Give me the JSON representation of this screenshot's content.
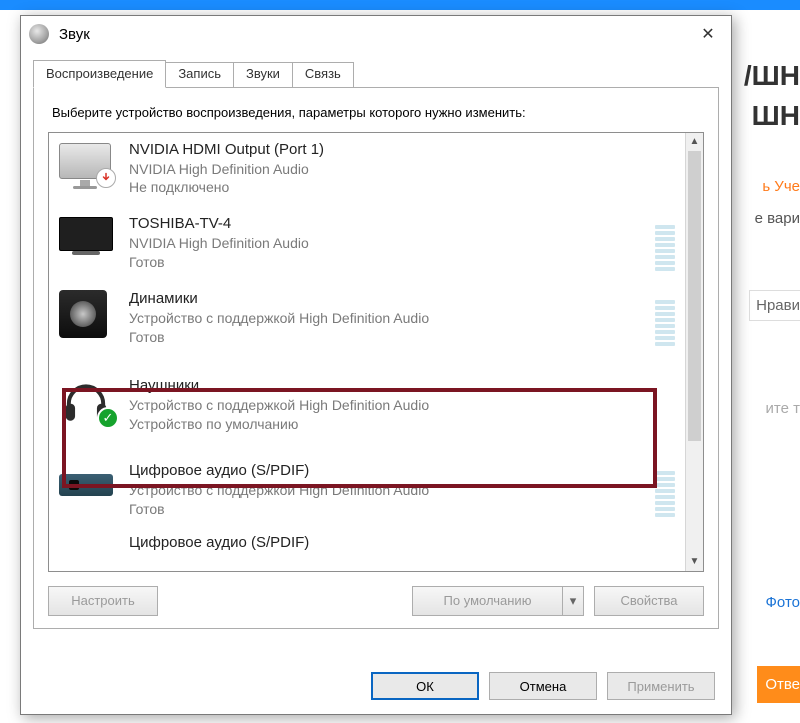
{
  "background": {
    "heading_frag1": "/ШН",
    "heading_frag2": "ШН",
    "line1": "ь Уче",
    "line2": "е вари",
    "like": "Нрави",
    "hint": "ите т",
    "photo": "Фото",
    "answer_button": "Отве"
  },
  "dialog": {
    "title": "Звук",
    "close_glyph": "✕",
    "tabs": {
      "playback": "Воспроизведение",
      "recording": "Запись",
      "sounds": "Звуки",
      "comm": "Связь"
    },
    "instruction": "Выберите устройство воспроизведения, параметры которого нужно изменить:",
    "devices": [
      {
        "title": "NVIDIA HDMI Output (Port 1)",
        "sub1": "NVIDIA High Definition Audio",
        "sub2": "Не подключено",
        "icon": "monitor-down",
        "vu": false
      },
      {
        "title": "TOSHIBA-TV-4",
        "sub1": "NVIDIA High Definition Audio",
        "sub2": "Готов",
        "icon": "tv",
        "vu": true
      },
      {
        "title": "Динамики",
        "sub1": "Устройство с поддержкой High Definition Audio",
        "sub2": "Готов",
        "icon": "speaker",
        "vu": true
      },
      {
        "title": "Наушники",
        "sub1": "Устройство с поддержкой High Definition Audio",
        "sub2": "Устройство по умолчанию",
        "icon": "headphones-default",
        "vu": false
      },
      {
        "title": "Цифровое аудио (S/PDIF)",
        "sub1": "Устройство с поддержкой High Definition Audio",
        "sub2": "Готов",
        "icon": "spdif",
        "vu": true
      },
      {
        "title": "Цифровое аудио (S/PDIF)",
        "sub1": "",
        "sub2": "",
        "icon": "none",
        "vu": false
      }
    ],
    "buttons": {
      "configure": "Настроить",
      "set_default": "По умолчанию",
      "properties": "Свойства"
    },
    "footer": {
      "ok": "ОК",
      "cancel": "Отмена",
      "apply": "Применить"
    }
  }
}
